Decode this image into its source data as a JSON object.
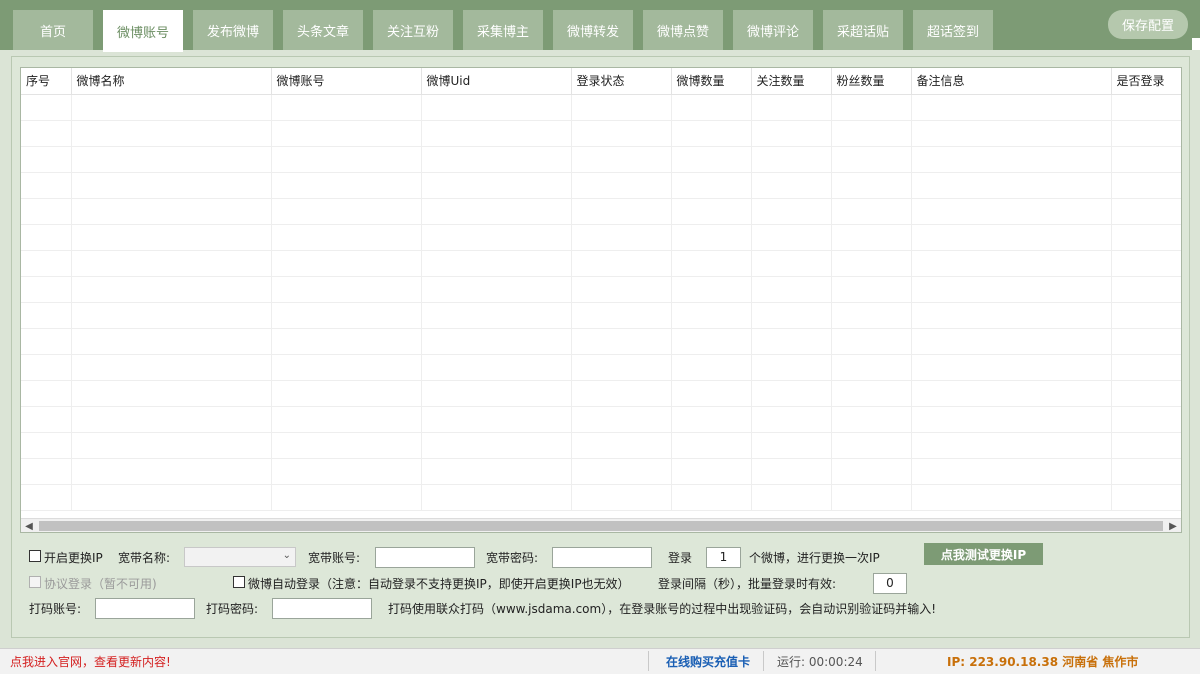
{
  "tabs": [
    {
      "label": "首页"
    },
    {
      "label": "微博账号"
    },
    {
      "label": "发布微博"
    },
    {
      "label": "头条文章"
    },
    {
      "label": "关注互粉"
    },
    {
      "label": "采集博主"
    },
    {
      "label": "微博转发"
    },
    {
      "label": "微博点赞"
    },
    {
      "label": "微博评论"
    },
    {
      "label": "采超话贴"
    },
    {
      "label": "超话签到"
    }
  ],
  "save_config": "保存配置",
  "table": {
    "columns": [
      "序号",
      "微博名称",
      "微博账号",
      "微博Uid",
      "登录状态",
      "微博数量",
      "关注数量",
      "粉丝数量",
      "备注信息",
      "是否登录"
    ]
  },
  "settings": {
    "enable_ip_change": "开启更换IP",
    "broadband_name_label": "宽带名称:",
    "broadband_account_label": "宽带账号:",
    "broadband_account_value": "",
    "broadband_password_label": "宽带密码:",
    "broadband_password_value": "",
    "login_label": "登录",
    "login_count_value": "1",
    "per_weibo_text": "个微博，进行更换一次IP",
    "test_ip_button": "点我测试更换IP",
    "protocol_login": "协议登录（暂不可用)",
    "auto_login": "微博自动登录（注意：自动登录不支持更换IP，即使开启更换IP也无效）",
    "login_interval_label": "登录间隔（秒），批量登录时有效:",
    "login_interval_value": "0",
    "captcha_account_label": "打码账号:",
    "captcha_account_value": "",
    "captcha_password_label": "打码密码:",
    "captcha_password_value": "",
    "captcha_note": "打码使用联众打码（www.jsdama.com），在登录账号的过程中出现验证码，会自动识别验证码并输入!"
  },
  "status_bar": {
    "website_link": "点我进入官网，查看更新内容!",
    "buy_card": "在线购买充值卡",
    "runtime": "运行: 00:00:24",
    "ip": "IP: 223.90.18.38  河南省 焦作市"
  },
  "colors": {
    "accent": "#7d9b75",
    "link_red": "#d42020",
    "link_blue": "#1a5fb4",
    "ip_orange": "#c8700a"
  }
}
